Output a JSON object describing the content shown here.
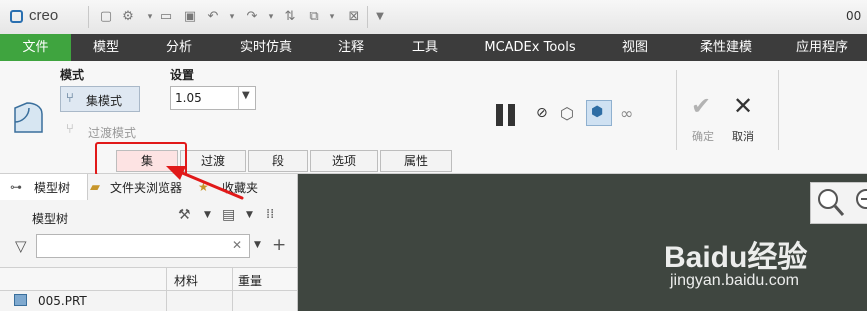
{
  "app": {
    "logo": "creo",
    "title_right": "00"
  },
  "menubar": {
    "items": [
      "文件",
      "模型",
      "分析",
      "实时仿真",
      "注释",
      "工具",
      "MCADEx Tools",
      "视图",
      "柔性建模",
      "应用程序"
    ],
    "active_color": "#3fa43f"
  },
  "ribbon": {
    "mode_label": "模式",
    "set_mode": "集模式",
    "transition_mode": "过渡模式",
    "settings_label": "设置",
    "settings_value": "1.05",
    "ok": "确定",
    "cancel": "取消"
  },
  "tabs": [
    "集",
    "过渡",
    "段",
    "选项",
    "属性"
  ],
  "panel": {
    "tabs": [
      "模型树",
      "文件夹浏览器",
      "收藏夹"
    ],
    "tree_label": "模型树",
    "columns": [
      "材料",
      "重量"
    ],
    "first_item": "005.PRT"
  },
  "watermark": {
    "brand": "Baidu经验",
    "url": "jingyan.baidu.com"
  },
  "colors": {
    "highlight": "#e11919",
    "graphics_bg": "#3f4640",
    "menubar_bg": "#3c3c3c"
  }
}
